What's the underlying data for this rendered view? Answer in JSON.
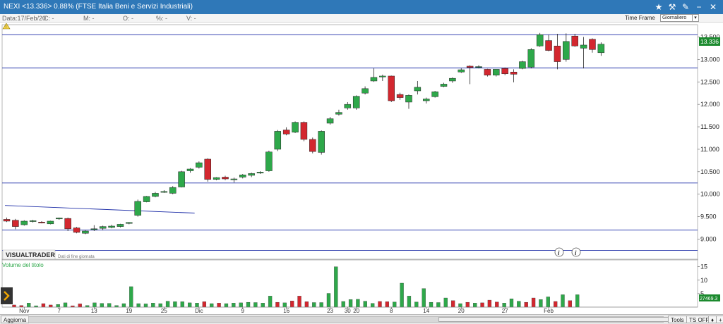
{
  "titlebar": {
    "title": "NEXI <13.336> 0.88%  (FTSE Italia Beni e Servizi Industriali)"
  },
  "infobar": {
    "date": "Data:17/Feb/20",
    "c": "C: -",
    "m": "M: -",
    "o": "O: -",
    "pct": "%: -",
    "v": "V: -"
  },
  "timeframe": {
    "label": "Time Frame",
    "value": "Giornaliero"
  },
  "watermark": {
    "brand": "VISUALTRADER",
    "sub": "Dati di fine giornata"
  },
  "price_label": "13.336",
  "volume_label": "Volume del titolo",
  "volume_value": "27469.3",
  "bottombar": {
    "refresh": "Aggiorna",
    "tools": "Tools",
    "ts": "TS OFF"
  },
  "colors": {
    "up": "#2ea84a",
    "down": "#d3272f",
    "hline": "#1f2fa8",
    "price_tag": "#1b8a2e"
  },
  "chart_data": {
    "type": "candlestick",
    "price_axis": {
      "ticks": [
        9.0,
        9.5,
        10.0,
        10.5,
        11.0,
        11.5,
        12.0,
        12.5,
        13.0,
        13.5
      ],
      "tick_labels": [
        "9.000",
        "9.500",
        "10.000",
        "10.500",
        "11.000",
        "11.500",
        "12.000",
        "12.500",
        "13.000",
        "13.500"
      ],
      "range": [
        8.6,
        13.68
      ]
    },
    "volume_axis": {
      "ticks": [
        5,
        10,
        15
      ],
      "range": [
        0,
        17
      ]
    },
    "x_labels": [
      {
        "i": 2,
        "text": "Nov",
        "color": "#1f2fa8"
      },
      {
        "i": 6,
        "text": "7"
      },
      {
        "i": 10,
        "text": "13"
      },
      {
        "i": 14,
        "text": "19"
      },
      {
        "i": 18,
        "text": "25"
      },
      {
        "i": 22,
        "text": "Dic",
        "color": "#1f2fa8"
      },
      {
        "i": 27,
        "text": "9"
      },
      {
        "i": 32,
        "text": "16"
      },
      {
        "i": 37,
        "text": "23"
      },
      {
        "i": 39,
        "text": "30"
      },
      {
        "i": 40,
        "text": "20",
        "color": "#d3272f"
      },
      {
        "i": 44,
        "text": "8"
      },
      {
        "i": 48,
        "text": "14"
      },
      {
        "i": 52,
        "text": "20"
      },
      {
        "i": 57,
        "text": "27"
      },
      {
        "i": 62,
        "text": "Feb",
        "color": "#1f2fa8"
      }
    ],
    "candles": [
      {
        "o": 9.44,
        "h": 9.48,
        "l": 9.38,
        "c": 9.4
      },
      {
        "o": 9.42,
        "h": 9.45,
        "l": 9.22,
        "c": 9.28
      },
      {
        "o": 9.32,
        "h": 9.42,
        "l": 9.3,
        "c": 9.4
      },
      {
        "o": 9.4,
        "h": 9.43,
        "l": 9.37,
        "c": 9.41
      },
      {
        "o": 9.38,
        "h": 9.4,
        "l": 9.35,
        "c": 9.36
      },
      {
        "o": 9.34,
        "h": 9.41,
        "l": 9.33,
        "c": 9.4
      },
      {
        "o": 9.45,
        "h": 9.48,
        "l": 9.43,
        "c": 9.47
      },
      {
        "o": 9.46,
        "h": 9.48,
        "l": 9.18,
        "c": 9.23
      },
      {
        "o": 9.25,
        "h": 9.27,
        "l": 9.13,
        "c": 9.15
      },
      {
        "o": 9.13,
        "h": 9.2,
        "l": 9.11,
        "c": 9.18
      },
      {
        "o": 9.22,
        "h": 9.31,
        "l": 9.18,
        "c": 9.23
      },
      {
        "o": 9.24,
        "h": 9.3,
        "l": 9.2,
        "c": 9.28
      },
      {
        "o": 9.26,
        "h": 9.32,
        "l": 9.24,
        "c": 9.29
      },
      {
        "o": 9.28,
        "h": 9.34,
        "l": 9.26,
        "c": 9.33
      },
      {
        "o": 9.35,
        "h": 9.38,
        "l": 9.33,
        "c": 9.37
      },
      {
        "o": 9.53,
        "h": 9.88,
        "l": 9.5,
        "c": 9.84
      },
      {
        "o": 9.83,
        "h": 9.96,
        "l": 9.82,
        "c": 9.95
      },
      {
        "o": 9.95,
        "h": 10.05,
        "l": 9.93,
        "c": 10.02
      },
      {
        "o": 10.05,
        "h": 10.09,
        "l": 10.03,
        "c": 10.06
      },
      {
        "o": 10.02,
        "h": 10.18,
        "l": 10.0,
        "c": 10.15
      },
      {
        "o": 10.16,
        "h": 10.52,
        "l": 10.15,
        "c": 10.5
      },
      {
        "o": 10.52,
        "h": 10.58,
        "l": 10.48,
        "c": 10.56
      },
      {
        "o": 10.6,
        "h": 10.73,
        "l": 10.57,
        "c": 10.7
      },
      {
        "o": 10.78,
        "h": 10.8,
        "l": 10.28,
        "c": 10.33
      },
      {
        "o": 10.33,
        "h": 10.38,
        "l": 10.31,
        "c": 10.37
      },
      {
        "o": 10.38,
        "h": 10.41,
        "l": 10.31,
        "c": 10.34
      },
      {
        "o": 10.33,
        "h": 10.37,
        "l": 10.26,
        "c": 10.34
      },
      {
        "o": 10.38,
        "h": 10.45,
        "l": 10.35,
        "c": 10.43
      },
      {
        "o": 10.42,
        "h": 10.48,
        "l": 10.38,
        "c": 10.46
      },
      {
        "o": 10.47,
        "h": 10.51,
        "l": 10.45,
        "c": 10.49
      },
      {
        "o": 10.52,
        "h": 10.97,
        "l": 10.5,
        "c": 10.94
      },
      {
        "o": 11.0,
        "h": 11.43,
        "l": 10.96,
        "c": 11.4
      },
      {
        "o": 11.43,
        "h": 11.49,
        "l": 11.31,
        "c": 11.34
      },
      {
        "o": 11.38,
        "h": 11.62,
        "l": 11.36,
        "c": 11.6
      },
      {
        "o": 11.6,
        "h": 11.62,
        "l": 11.18,
        "c": 11.22
      },
      {
        "o": 11.22,
        "h": 11.26,
        "l": 10.91,
        "c": 10.95
      },
      {
        "o": 10.93,
        "h": 11.42,
        "l": 10.88,
        "c": 11.4
      },
      {
        "o": 11.58,
        "h": 11.72,
        "l": 11.55,
        "c": 11.68
      },
      {
        "o": 11.78,
        "h": 11.88,
        "l": 11.75,
        "c": 11.82
      },
      {
        "o": 11.92,
        "h": 12.05,
        "l": 11.88,
        "c": 12.0
      },
      {
        "o": 11.92,
        "h": 12.2,
        "l": 11.88,
        "c": 12.18
      },
      {
        "o": 12.25,
        "h": 12.4,
        "l": 12.22,
        "c": 12.35
      },
      {
        "o": 12.52,
        "h": 12.8,
        "l": 12.5,
        "c": 12.6
      },
      {
        "o": 12.61,
        "h": 12.66,
        "l": 12.52,
        "c": 12.63
      },
      {
        "o": 12.63,
        "h": 12.64,
        "l": 12.05,
        "c": 12.08
      },
      {
        "o": 12.22,
        "h": 12.26,
        "l": 12.1,
        "c": 12.15
      },
      {
        "o": 12.05,
        "h": 12.22,
        "l": 11.9,
        "c": 12.2
      },
      {
        "o": 12.3,
        "h": 12.52,
        "l": 12.22,
        "c": 12.38
      },
      {
        "o": 12.08,
        "h": 12.15,
        "l": 12.02,
        "c": 12.12
      },
      {
        "o": 12.17,
        "h": 12.3,
        "l": 12.15,
        "c": 12.28
      },
      {
        "o": 12.4,
        "h": 12.48,
        "l": 12.38,
        "c": 12.45
      },
      {
        "o": 12.52,
        "h": 12.6,
        "l": 12.48,
        "c": 12.58
      },
      {
        "o": 12.72,
        "h": 12.8,
        "l": 12.7,
        "c": 12.77
      },
      {
        "o": 12.85,
        "h": 12.87,
        "l": 12.45,
        "c": 12.82
      },
      {
        "o": 12.83,
        "h": 12.87,
        "l": 12.8,
        "c": 12.84
      },
      {
        "o": 12.78,
        "h": 12.79,
        "l": 12.62,
        "c": 12.65
      },
      {
        "o": 12.65,
        "h": 12.78,
        "l": 12.62,
        "c": 12.78
      },
      {
        "o": 12.8,
        "h": 12.82,
        "l": 12.65,
        "c": 12.68
      },
      {
        "o": 12.72,
        "h": 12.78,
        "l": 12.49,
        "c": 12.67
      },
      {
        "o": 12.8,
        "h": 12.97,
        "l": 12.78,
        "c": 12.95
      },
      {
        "o": 12.83,
        "h": 13.25,
        "l": 12.8,
        "c": 13.22
      },
      {
        "o": 13.3,
        "h": 13.59,
        "l": 13.28,
        "c": 13.55
      },
      {
        "o": 13.42,
        "h": 13.55,
        "l": 13.18,
        "c": 13.2
      },
      {
        "o": 13.3,
        "h": 13.57,
        "l": 12.78,
        "c": 12.95
      },
      {
        "o": 13.0,
        "h": 13.58,
        "l": 12.95,
        "c": 13.4
      },
      {
        "o": 13.52,
        "h": 13.57,
        "l": 13.28,
        "c": 13.3
      },
      {
        "o": 13.25,
        "h": 13.5,
        "l": 12.8,
        "c": 13.32
      },
      {
        "o": 13.45,
        "h": 13.47,
        "l": 13.15,
        "c": 13.22
      },
      {
        "o": 13.15,
        "h": 13.38,
        "l": 13.08,
        "c": 13.34
      }
    ],
    "volumes": [
      0.8,
      0.6,
      1.5,
      0.5,
      1.3,
      0.8,
      1.0,
      1.6,
      0.5,
      1.2,
      0.6,
      1.6,
      1.4,
      1.4,
      0.6,
      1.3,
      7.6,
      1.3,
      1.2,
      1.5,
      1.3,
      2.2,
      2.0,
      2.0,
      1.6,
      1.5,
      2.0,
      1.3,
      1.5,
      1.3,
      1.5,
      1.6,
      1.8,
      1.7,
      1.5,
      4.1,
      1.8,
      1.6,
      2.3,
      4.1,
      2.0,
      1.7,
      1.7,
      5.1,
      15.0,
      2.1,
      2.8,
      2.9,
      2.2,
      1.4,
      2.1,
      2.0,
      1.9,
      8.9,
      4.1,
      1.9,
      6.9,
      1.8,
      1.7,
      3.4,
      2.4,
      1.3,
      1.8,
      1.5,
      1.6,
      2.6,
      1.9,
      1.5,
      3.1,
      2.2,
      1.8,
      3.4,
      2.8,
      3.8,
      2.1,
      4.6,
      2.4,
      4.6
    ],
    "horizontal_lines": [
      13.55,
      12.81,
      10.25,
      9.2,
      8.75
    ],
    "trendline": {
      "from": {
        "i": -0.2,
        "v": 9.75
      },
      "to": {
        "i": 21.5,
        "v": 9.58
      }
    }
  }
}
